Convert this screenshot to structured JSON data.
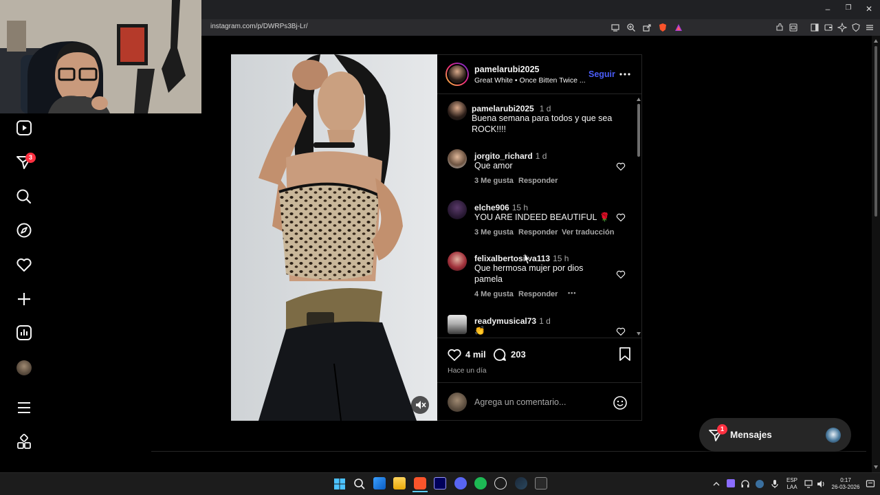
{
  "browser": {
    "url": "instagram.com/p/DWRPs3Bj-Lr/",
    "window_controls": [
      "–",
      "❐",
      "✕"
    ]
  },
  "sidebar": {
    "items": [
      {
        "name": "reels-icon"
      },
      {
        "name": "messages-icon",
        "badge": "3"
      },
      {
        "name": "search-icon"
      },
      {
        "name": "explore-icon"
      },
      {
        "name": "notifications-icon"
      },
      {
        "name": "create-icon"
      },
      {
        "name": "dashboard-icon"
      },
      {
        "name": "profile-avatar"
      },
      {
        "name": "more-menu-icon"
      },
      {
        "name": "also-from-meta-icon"
      }
    ]
  },
  "post": {
    "author": "pamelarubi2025",
    "audio": "Great White • Once Bitten Twice ...",
    "follow_label": "Seguir",
    "caption": {
      "user": "pamelarubi2025",
      "time": "1 d",
      "text": "Buena semana para todos y que sea ROCK!!!!"
    },
    "comments": [
      {
        "user": "jorgito_richard",
        "time": "1 d",
        "text": "Que amor",
        "likes": "3 Me gusta",
        "reply": "Responder"
      },
      {
        "user": "elche906",
        "time": "15 h",
        "text": "YOU ARE INDEED BEAUTIFUL 🌹",
        "likes": "3 Me gusta",
        "reply": "Responder",
        "translate": "Ver traducción"
      },
      {
        "user": "felixalbertosilva113",
        "time": "15 h",
        "text": "Que hermosa mujer por dios pamela",
        "likes": "4 Me gusta",
        "reply": "Responder",
        "more": "•••"
      },
      {
        "user": "readymusical73",
        "time": "1 d",
        "text": "👏"
      }
    ],
    "like_count": "4 mil",
    "comment_count": "203",
    "posted_ago": "Hace un día",
    "comment_placeholder": "Agrega un comentario..."
  },
  "messages_pill": {
    "label": "Mensajes",
    "badge": "1"
  },
  "taskbar": {
    "lang_top": "ESP",
    "lang_bottom": "LAA",
    "time": "0:17",
    "date": "26-03-2026"
  },
  "colors": {
    "accent_blue": "#4a5df9",
    "badge_red": "#ff3040",
    "background": "#000000",
    "panel_border": "#262626",
    "muted_text": "#a8a8a8"
  }
}
